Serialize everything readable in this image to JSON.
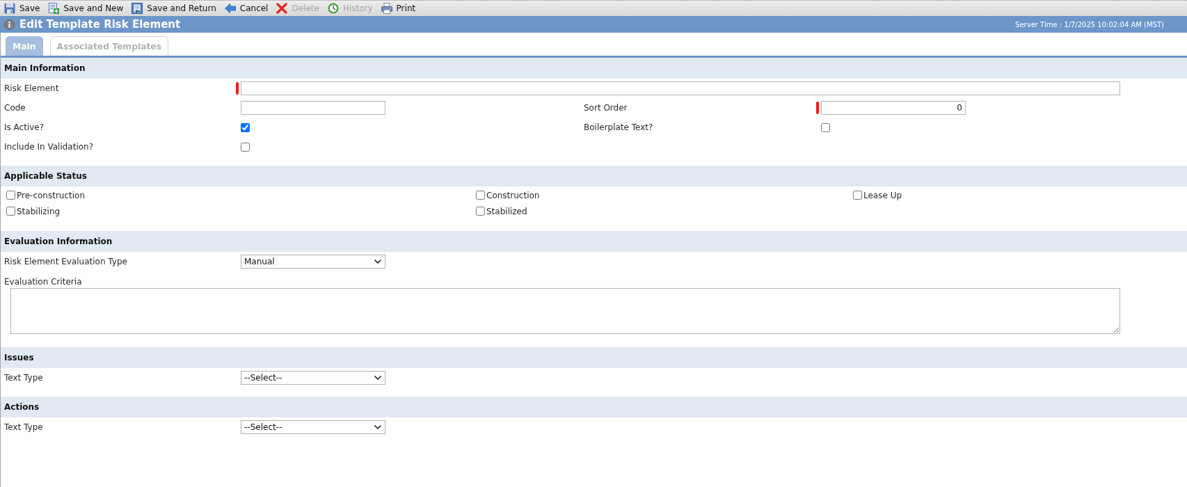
{
  "toolbar": [
    {
      "label": "Save",
      "disabled": false
    },
    {
      "label": "Save and New",
      "disabled": false
    },
    {
      "label": "Save and Return",
      "disabled": false
    },
    {
      "label": "Cancel",
      "disabled": false
    },
    {
      "label": "Delete",
      "disabled": true
    },
    {
      "label": "History",
      "disabled": true
    },
    {
      "label": "Print",
      "disabled": false
    }
  ],
  "header": {
    "title": "Edit Template Risk Element",
    "server_time": "Server Time : 1/7/2025 10:02:04 AM (MST)"
  },
  "tabs": [
    {
      "label": "Main",
      "selected": true
    },
    {
      "label": "Associated Templates",
      "selected": false
    }
  ],
  "sections": [
    {
      "title": "Main Information",
      "kind": "form",
      "rows": [
        [
          {
            "label": "Risk Element",
            "kind": "text",
            "required": true
          }
        ],
        [
          {
            "label": "Code",
            "kind": "text",
            "required": false
          },
          {
            "label": "Sort Order",
            "kind": "number",
            "required": true,
            "value": "0"
          }
        ],
        [
          {
            "label": "Is Active?",
            "kind": "checkbox",
            "required": false,
            "checked": true
          },
          {
            "label": "Boilerplate Text?",
            "kind": "checkbox",
            "required": false,
            "checked": false
          }
        ],
        [
          {
            "label": "Include In Validation?",
            "kind": "checkbox",
            "required": false,
            "checked": false
          }
        ]
      ]
    },
    {
      "title": "Applicable Status",
      "kind": "checkbox_grid",
      "items": [
        {
          "label": "Pre-construction",
          "checked": false
        },
        {
          "label": "Construction",
          "checked": false
        },
        {
          "label": "Lease Up",
          "checked": false
        },
        {
          "label": "Stabilizing",
          "checked": false
        },
        {
          "label": "Stabilized",
          "checked": false
        }
      ]
    },
    {
      "title": "Evaluation Information",
      "kind": "form",
      "rows": [
        [
          {
            "label": "Risk Element Evaluation Type",
            "kind": "select",
            "required": false,
            "value": "Manual"
          }
        ],
        [
          {
            "label": "Evaluation Criteria",
            "kind": "textarea",
            "required": false
          }
        ]
      ]
    },
    {
      "title": "Issues",
      "kind": "form",
      "rows": [
        [
          {
            "label": "Text Type",
            "kind": "select",
            "required": false,
            "value": "--Select--"
          }
        ]
      ]
    },
    {
      "title": "Actions",
      "kind": "form",
      "rows": [
        [
          {
            "label": "Text Type",
            "kind": "select",
            "required": false,
            "value": "--Select--"
          }
        ]
      ]
    }
  ]
}
